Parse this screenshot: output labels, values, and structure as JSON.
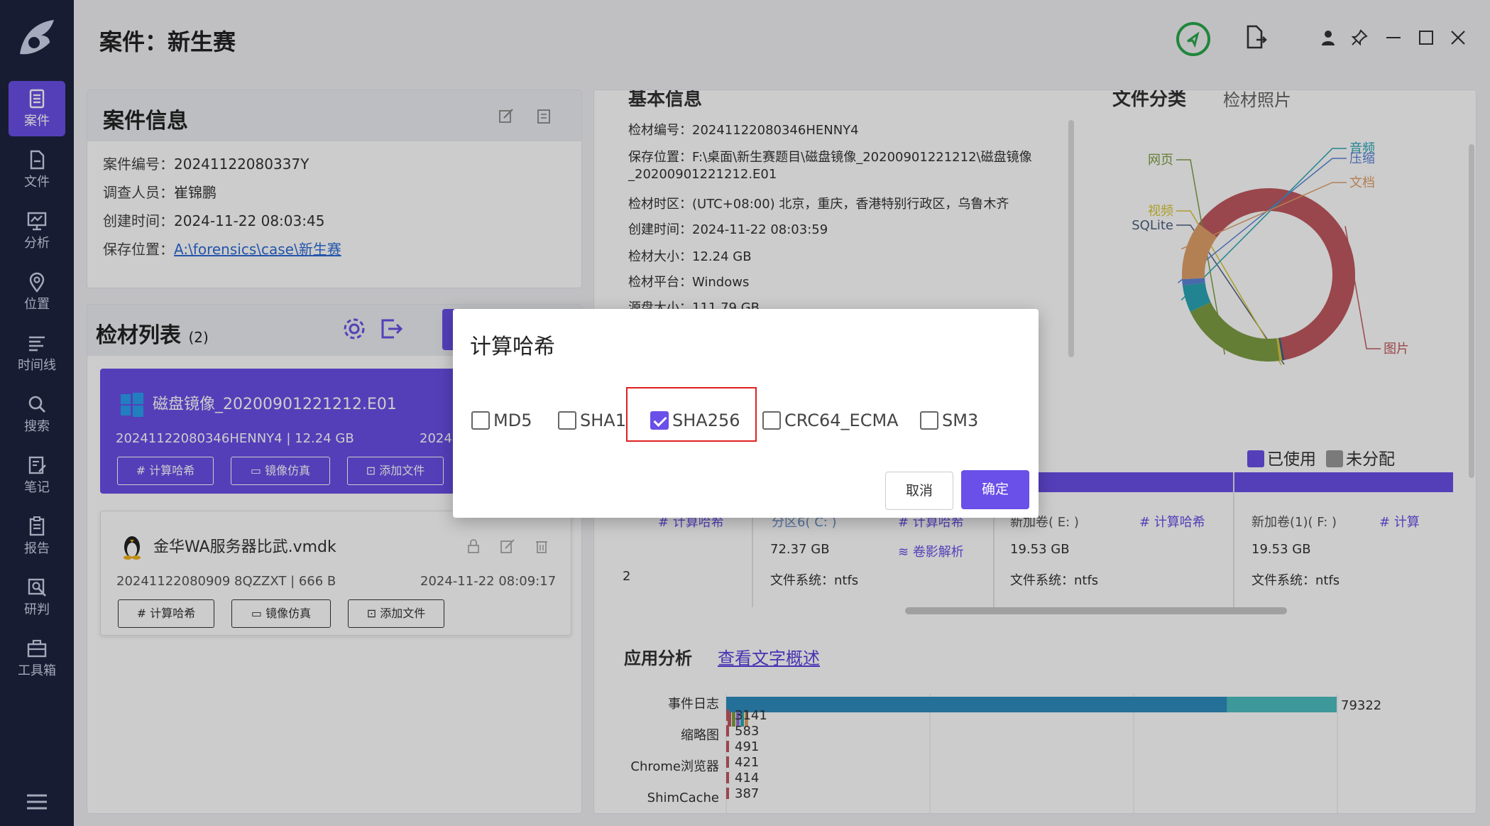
{
  "nav": {
    "items": [
      {
        "label": "案件",
        "icon": "case-icon"
      },
      {
        "label": "文件",
        "icon": "file-icon"
      },
      {
        "label": "分析",
        "icon": "analysis-icon"
      },
      {
        "label": "位置",
        "icon": "location-icon"
      },
      {
        "label": "时间线",
        "icon": "timeline-icon"
      },
      {
        "label": "搜索",
        "icon": "search-icon"
      },
      {
        "label": "笔记",
        "icon": "note-icon"
      },
      {
        "label": "报告",
        "icon": "report-icon"
      },
      {
        "label": "研判",
        "icon": "judge-icon"
      },
      {
        "label": "工具箱",
        "icon": "toolbox-icon"
      }
    ],
    "active": "案件"
  },
  "header": {
    "title": "案件：新生赛"
  },
  "case_info": {
    "title": "案件信息",
    "rows": [
      {
        "k": "案件编号：",
        "v": "20241122080337Y"
      },
      {
        "k": "调查人员：",
        "v": "崔锦鹏"
      },
      {
        "k": "创建时间：",
        "v": "2024-11-22 08:03:45"
      },
      {
        "k": "保存位置：",
        "v": "A:\\forensics\\case\\新生赛"
      }
    ]
  },
  "evidence": {
    "title": "检材列表",
    "count": "(2)",
    "items": [
      {
        "name": "磁盘镜像_20200901221212.E01",
        "meta": "20241122080346HENNY4 | 12.24 GB",
        "time": "2024",
        "buttons": [
          "计算哈希",
          "镜像仿真",
          "添加文件"
        ]
      },
      {
        "name": "金华WA服务器比武.vmdk",
        "meta": "20241122080909 8QZZXT | 666 B",
        "time": "2024-11-22 08:09:17",
        "buttons": [
          "计算哈希",
          "镜像仿真",
          "添加文件"
        ]
      }
    ]
  },
  "basic": {
    "title": "基本信息",
    "rows": [
      "检材编号：20241122080346HENNY4",
      "保存位置：F:\\桌面\\新生赛题目\\磁盘镜像_20200901221212\\磁盘镜像",
      "_20200901221212.E01",
      "检材时区：(UTC+08:00) 北京，重庆，香港特别行政区，乌鲁木齐",
      "创建时间：2024-11-22 08:03:59",
      "检材大小：12.24 GB",
      "检材平台：Windows",
      "源盘大小：111.79 GB"
    ]
  },
  "file_class": {
    "title": "文件分类",
    "tab2": "检材照片",
    "slices": [
      {
        "label": "图片",
        "value": 62,
        "color": "#c0595f"
      },
      {
        "label": "SQLite",
        "value": 0.5,
        "color": "#4b5f80"
      },
      {
        "label": "视频",
        "value": 0.5,
        "color": "#d8c637"
      },
      {
        "label": "网页",
        "value": 20,
        "color": "#7e9e44"
      },
      {
        "label": "音频",
        "value": 5,
        "color": "#2aa5b5"
      },
      {
        "label": "压缩",
        "value": 1.2,
        "color": "#5a85d8"
      },
      {
        "label": "文档",
        "value": 10.8,
        "color": "#e0a06a"
      }
    ]
  },
  "partitions": {
    "legend": [
      "已使用",
      "未分配"
    ],
    "cols": [
      {
        "name": "分区6( C: )",
        "size": "72.37 GB",
        "fs": "文件系统：ntfs",
        "a1": "计算哈希",
        "a2": "卷影解析"
      },
      {
        "name": "新加卷( E: )",
        "size": "19.53 GB",
        "fs": "文件系统：ntfs",
        "a1": "计算哈希"
      },
      {
        "name": "新加卷(1)( F: )",
        "size": "19.53 GB",
        "fs": "文件系统：ntfs",
        "a1": "计算"
      }
    ],
    "left_action": "计算哈希"
  },
  "app_analysis": {
    "title": "应用分析",
    "link": "查看文字概述"
  },
  "chart_data": {
    "type": "bar",
    "orientation": "horizontal",
    "categories": [
      "事件日志",
      "缩略图",
      "Chrome浏览器",
      "ShimCache"
    ],
    "values": [
      79322,
      583,
      421,
      387
    ],
    "extra_labels": [
      "3141",
      "491",
      "414"
    ]
  },
  "dialog": {
    "title": "计算哈希",
    "options": [
      {
        "label": "MD5",
        "checked": false
      },
      {
        "label": "SHA1",
        "checked": false
      },
      {
        "label": "SHA256",
        "checked": true
      },
      {
        "label": "CRC64_ECMA",
        "checked": false
      },
      {
        "label": "SM3",
        "checked": false
      }
    ],
    "cancel": "取消",
    "ok": "确定"
  }
}
